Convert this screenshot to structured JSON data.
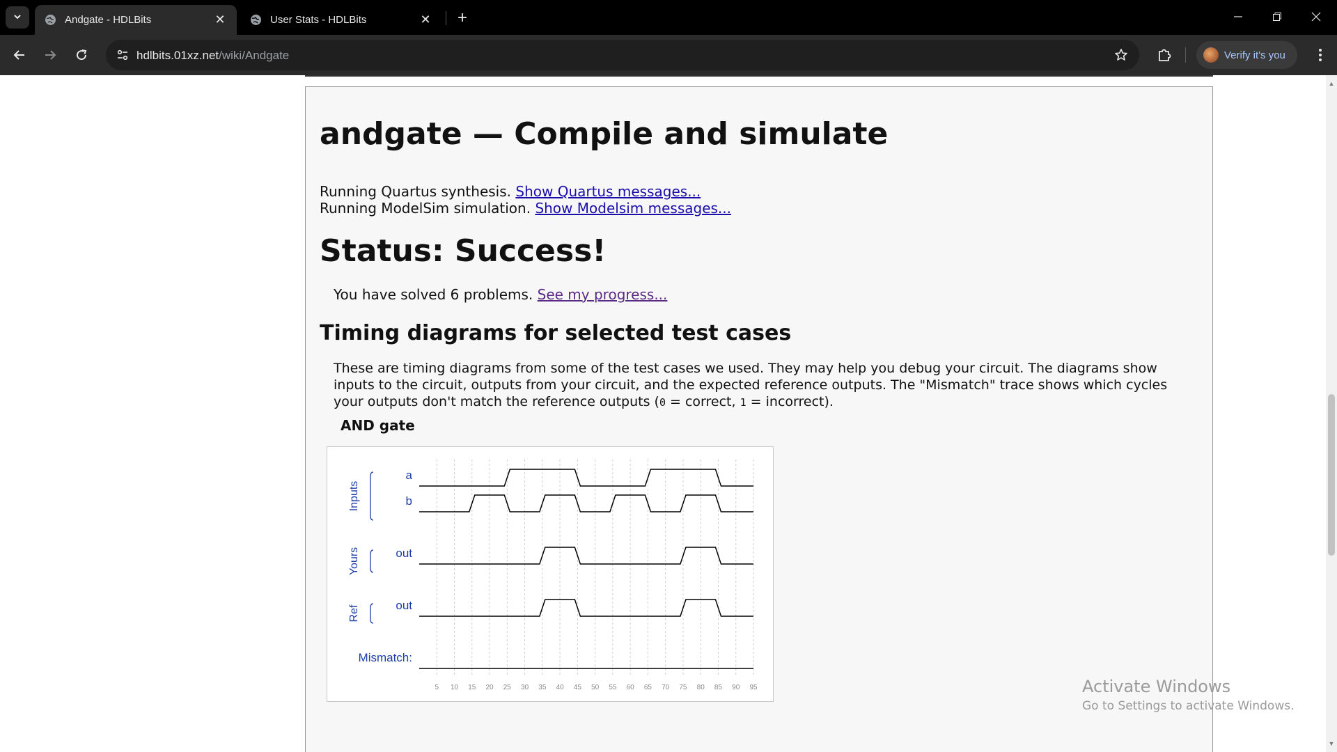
{
  "browser": {
    "tabs": [
      {
        "title": "Andgate - HDLBits",
        "active": true
      },
      {
        "title": "User Stats - HDLBits",
        "active": false
      }
    ],
    "url_host": "hdlbits.01xz.net",
    "url_path": "/wiki/Andgate",
    "verify_label": "Verify it's you",
    "icons": {
      "tab_search": "chevron-down-icon",
      "favicon": "globe-icon",
      "close": "close-icon",
      "new_tab": "plus-icon",
      "back": "arrow-left-icon",
      "forward": "arrow-right-icon",
      "reload": "reload-icon",
      "site_info": "tune-icon",
      "bookmark": "star-icon",
      "extensions": "puzzle-icon",
      "menu": "kebab-menu-icon",
      "minimize": "minimize-icon",
      "restore": "restore-icon",
      "close_window": "close-icon"
    }
  },
  "page": {
    "heading": "andgate — Compile and simulate",
    "quartus_text": "Running Quartus synthesis. ",
    "quartus_link": "Show Quartus messages...",
    "modelsim_text": "Running ModelSim simulation. ",
    "modelsim_link": "Show Modelsim messages...",
    "status_heading": "Status: Success!",
    "solved_text": "You have solved 6 problems. ",
    "progress_link": "See my progress...",
    "timing_heading": "Timing diagrams for selected test cases",
    "desc_1": "These are timing diagrams from some of the test cases we used. They may help you debug your circuit. The diagrams show inputs to the circuit, outputs from your circuit, and the expected reference outputs. The \"Mismatch\" trace shows which cycles your outputs don't match the reference outputs (",
    "desc_code0": "0",
    "desc_2": " = correct, ",
    "desc_code1": "1",
    "desc_3": " = incorrect).",
    "figure_title": "AND gate"
  },
  "chart_data": {
    "type": "timing",
    "x_ticks": [
      5,
      10,
      15,
      20,
      25,
      30,
      35,
      40,
      45,
      50,
      55,
      60,
      65,
      70,
      75,
      80,
      85,
      90,
      95
    ],
    "x_range": [
      0,
      95
    ],
    "group_labels": [
      "Inputs",
      "Yours",
      "Ref"
    ],
    "mismatch_label": "Mismatch:",
    "signals": [
      {
        "group": "Inputs",
        "name": "a",
        "transitions": [
          [
            0,
            0
          ],
          [
            25,
            1
          ],
          [
            45,
            0
          ],
          [
            65,
            1
          ],
          [
            85,
            0
          ]
        ]
      },
      {
        "group": "Inputs",
        "name": "b",
        "transitions": [
          [
            0,
            0
          ],
          [
            15,
            1
          ],
          [
            25,
            0
          ],
          [
            35,
            1
          ],
          [
            45,
            0
          ],
          [
            55,
            1
          ],
          [
            65,
            0
          ],
          [
            75,
            1
          ],
          [
            85,
            0
          ]
        ]
      },
      {
        "group": "Yours",
        "name": "out",
        "transitions": [
          [
            0,
            0
          ],
          [
            35,
            1
          ],
          [
            45,
            0
          ],
          [
            75,
            1
          ],
          [
            85,
            0
          ]
        ]
      },
      {
        "group": "Ref",
        "name": "out",
        "transitions": [
          [
            0,
            0
          ],
          [
            35,
            1
          ],
          [
            45,
            0
          ],
          [
            75,
            1
          ],
          [
            85,
            0
          ]
        ]
      },
      {
        "group": "Mismatch",
        "name": "Mismatch:",
        "transitions": [
          [
            0,
            0
          ]
        ]
      }
    ],
    "colors": {
      "label": "#1f3fa8",
      "trace": "#000000",
      "grid": "#cfcfcf",
      "tick": "#888888"
    }
  },
  "watermark": {
    "line1": "Activate Windows",
    "line2": "Go to Settings to activate Windows."
  }
}
